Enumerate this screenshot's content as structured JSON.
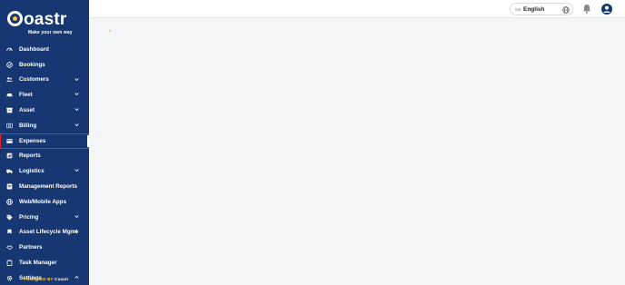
{
  "brand": {
    "logo_text": "oastr",
    "tagline": "Make your own way",
    "powered_by_prefix": "POWERED BY",
    "powered_by_name": "Coastr"
  },
  "header": {
    "language_code": "GB",
    "language_name": "English"
  },
  "sidebar": {
    "items": [
      {
        "label": "Dashboard",
        "icon": "dashboard-icon",
        "has_submenu": false
      },
      {
        "label": "Bookings",
        "icon": "bookings-icon",
        "has_submenu": false
      },
      {
        "label": "Customers",
        "icon": "customers-icon",
        "has_submenu": true
      },
      {
        "label": "Fleet",
        "icon": "fleet-icon",
        "has_submenu": true
      },
      {
        "label": "Asset",
        "icon": "asset-icon",
        "has_submenu": true
      },
      {
        "label": "Billing",
        "icon": "billing-icon",
        "has_submenu": true
      },
      {
        "label": "Expenses",
        "icon": "expenses-icon",
        "has_submenu": false,
        "selected": true
      },
      {
        "label": "Reports",
        "icon": "reports-icon",
        "has_submenu": false
      },
      {
        "label": "Logistics",
        "icon": "logistics-icon",
        "has_submenu": true
      },
      {
        "label": "Management Reports",
        "icon": "management-reports-icon",
        "has_submenu": false
      },
      {
        "label": "Web/Mobile Apps",
        "icon": "web-mobile-icon",
        "has_submenu": false
      },
      {
        "label": "Pricing",
        "icon": "pricing-icon",
        "has_submenu": true
      },
      {
        "label": "Asset Lifecycle Mgmt",
        "icon": "lifecycle-icon",
        "has_submenu": true
      },
      {
        "label": "Partners",
        "icon": "partners-icon",
        "has_submenu": false
      },
      {
        "label": "Task Manager",
        "icon": "task-manager-icon",
        "has_submenu": false
      },
      {
        "label": "Settings",
        "icon": "gear-icon",
        "has_submenu": true
      }
    ]
  },
  "colors": {
    "sidebar_bg": "#163772",
    "accent": "#f6c343",
    "selection_outline": "#e0242a"
  }
}
